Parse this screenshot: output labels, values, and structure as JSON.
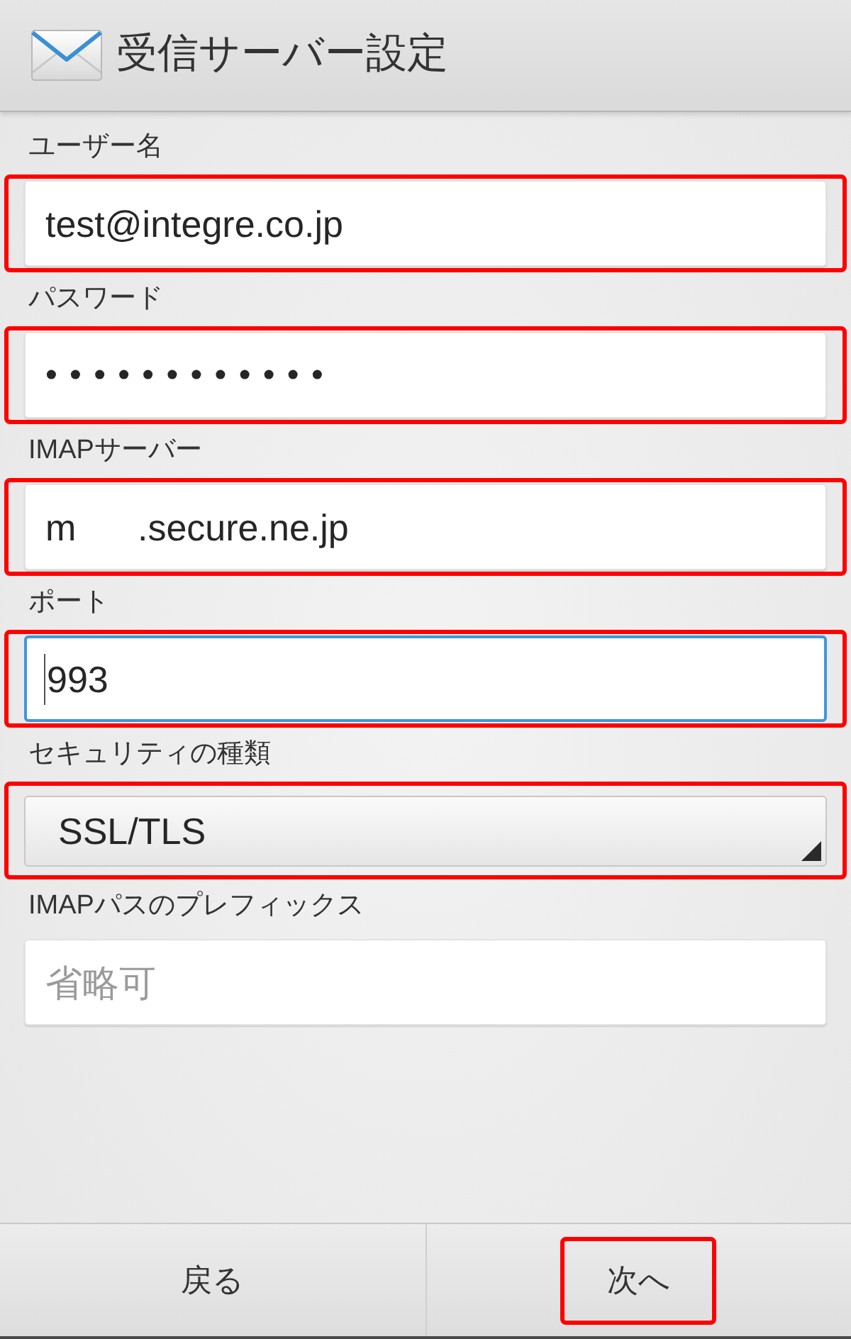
{
  "header": {
    "title": "受信サーバー設定"
  },
  "fields": [
    {
      "label": "ユーザー名",
      "kind": "text",
      "value": "test@integre.co.jp",
      "highlighted": true,
      "focused": false
    },
    {
      "label": "パスワード",
      "kind": "password",
      "value": "••••••••••••",
      "highlighted": true,
      "focused": false
    },
    {
      "label": "IMAPサーバー",
      "kind": "text",
      "value": "m      .secure.ne.jp",
      "highlighted": true,
      "focused": false
    },
    {
      "label": "ポート",
      "kind": "text",
      "value": "993",
      "highlighted": true,
      "focused": true
    },
    {
      "label": "セキュリティの種類",
      "kind": "select",
      "value": "SSL/TLS",
      "highlighted": true
    },
    {
      "label": "IMAPパスのプレフィックス",
      "kind": "text",
      "placeholder": "省略可",
      "highlighted": false,
      "focused": false
    }
  ],
  "buttons": [
    {
      "label": "戻る",
      "highlighted": false
    },
    {
      "label": "次へ",
      "highlighted": true
    }
  ]
}
